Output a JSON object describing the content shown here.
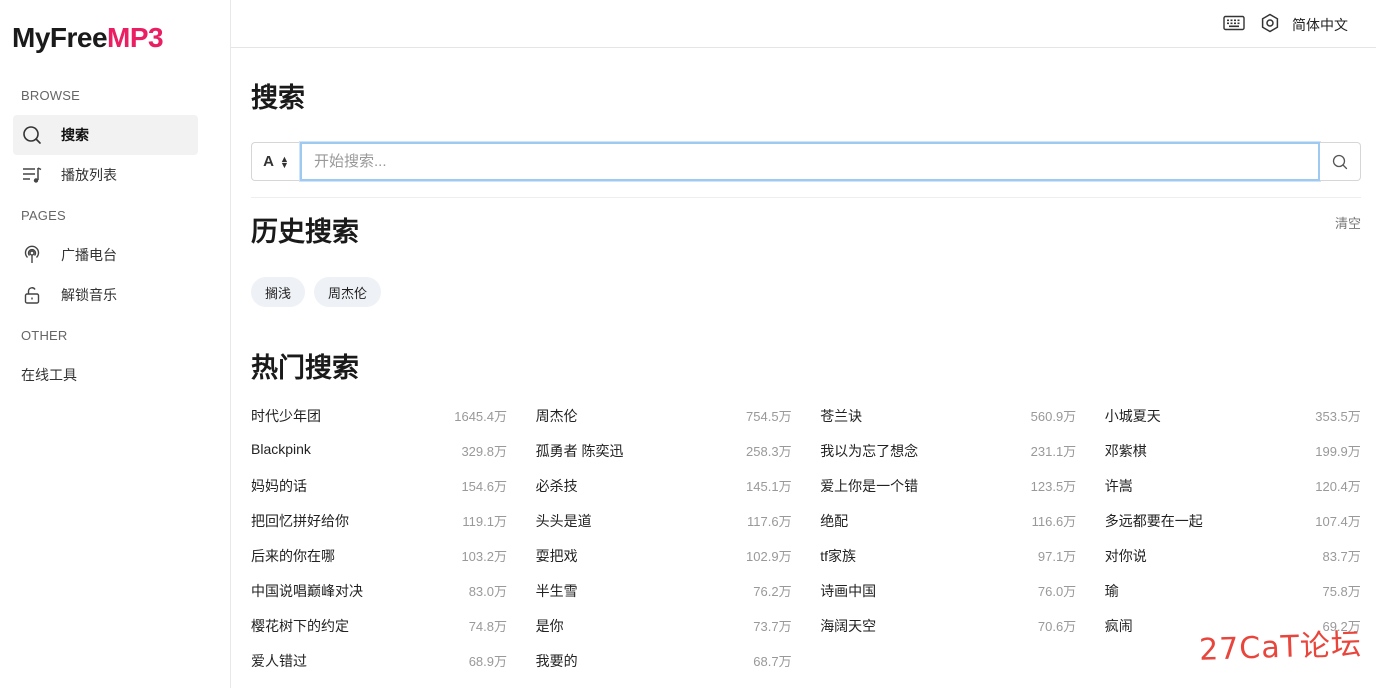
{
  "app": {
    "logo_main": "MyFree",
    "logo_accent": "MP3"
  },
  "sidebar": {
    "browse_label": "BROWSE",
    "pages_label": "PAGES",
    "other_label": "OTHER",
    "items": [
      {
        "label": "搜索",
        "icon": "search-icon"
      },
      {
        "label": "播放列表",
        "icon": "playlist-icon"
      },
      {
        "label": "广播电台",
        "icon": "radio-icon"
      },
      {
        "label": "解锁音乐",
        "icon": "unlock-icon"
      },
      {
        "label": "在线工具"
      }
    ]
  },
  "topbar": {
    "language": "简体中文"
  },
  "search": {
    "title": "搜索",
    "type_value": "A",
    "placeholder": "开始搜索..."
  },
  "history": {
    "title": "历史搜索",
    "clear_label": "清空",
    "chips": [
      "搁浅",
      "周杰伦"
    ]
  },
  "hot": {
    "title": "热门搜索",
    "items": [
      {
        "name": "时代少年团",
        "count": "1645.4万"
      },
      {
        "name": "周杰伦",
        "count": "754.5万"
      },
      {
        "name": "苍兰诀",
        "count": "560.9万"
      },
      {
        "name": "小城夏天",
        "count": "353.5万"
      },
      {
        "name": "Blackpink",
        "count": "329.8万"
      },
      {
        "name": "孤勇者 陈奕迅",
        "count": "258.3万"
      },
      {
        "name": "我以为忘了想念",
        "count": "231.1万"
      },
      {
        "name": "邓紫棋",
        "count": "199.9万"
      },
      {
        "name": "妈妈的话",
        "count": "154.6万"
      },
      {
        "name": "必杀技",
        "count": "145.1万"
      },
      {
        "name": "爱上你是一个错",
        "count": "123.5万"
      },
      {
        "name": "许嵩",
        "count": "120.4万"
      },
      {
        "name": "把回忆拼好给你",
        "count": "119.1万"
      },
      {
        "name": "头头是道",
        "count": "117.6万"
      },
      {
        "name": "绝配",
        "count": "116.6万"
      },
      {
        "name": "多远都要在一起",
        "count": "107.4万"
      },
      {
        "name": "后来的你在哪",
        "count": "103.2万"
      },
      {
        "name": "耍把戏",
        "count": "102.9万"
      },
      {
        "name": "tf家族",
        "count": "97.1万"
      },
      {
        "name": "对你说",
        "count": "83.7万"
      },
      {
        "name": "中国说唱巅峰对决",
        "count": "83.0万"
      },
      {
        "name": "半生雪",
        "count": "76.2万"
      },
      {
        "name": "诗画中国",
        "count": "76.0万"
      },
      {
        "name": "瑜",
        "count": "75.8万"
      },
      {
        "name": "樱花树下的约定",
        "count": "74.8万"
      },
      {
        "name": "是你",
        "count": "73.7万"
      },
      {
        "name": "海阔天空",
        "count": "70.6万"
      },
      {
        "name": "疯闹",
        "count": "69.2万"
      },
      {
        "name": "爱人错过",
        "count": "68.9万"
      },
      {
        "name": "我要的",
        "count": "68.7万"
      }
    ]
  },
  "watermark": "27CaT论坛",
  "colors": {
    "accent": "#e91e63",
    "input_focus": "#9ec9f0",
    "watermark": "#e8453c"
  }
}
